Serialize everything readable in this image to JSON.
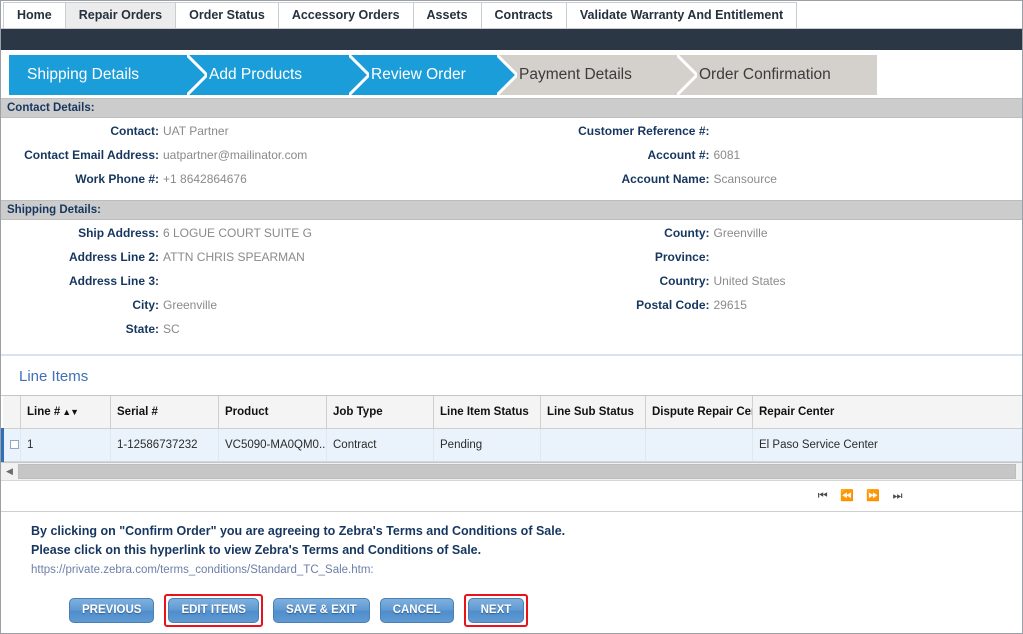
{
  "nav": {
    "tabs": [
      {
        "label": "Home",
        "active": false
      },
      {
        "label": "Repair Orders",
        "active": true
      },
      {
        "label": "Order Status",
        "active": false
      },
      {
        "label": "Accessory Orders",
        "active": false
      },
      {
        "label": "Assets",
        "active": false
      },
      {
        "label": "Contracts",
        "active": false
      },
      {
        "label": "Validate Warranty And Entitlement",
        "active": false
      }
    ]
  },
  "stepper": {
    "steps": [
      {
        "label": "Shipping Details",
        "state": "done"
      },
      {
        "label": "Add Products",
        "state": "done"
      },
      {
        "label": "Review Order",
        "state": "done"
      },
      {
        "label": "Payment Details",
        "state": "todo"
      },
      {
        "label": "Order Confirmation",
        "state": "todo"
      }
    ]
  },
  "contact_section": {
    "title": "Contact Details:",
    "left": [
      {
        "label": "Contact:",
        "value": "UAT Partner"
      },
      {
        "label": "Contact Email Address:",
        "value": "uatpartner@mailinator.com"
      },
      {
        "label": "Work Phone #:",
        "value": "+1 8642864676"
      }
    ],
    "right": [
      {
        "label": "Customer Reference #:",
        "value": ""
      },
      {
        "label": "Account #:",
        "value": "6081"
      },
      {
        "label": "Account Name:",
        "value": "Scansource"
      }
    ]
  },
  "shipping_section": {
    "title": "Shipping Details:",
    "left": [
      {
        "label": "Ship Address:",
        "value": "6 LOGUE COURT SUITE G"
      },
      {
        "label": "Address Line 2:",
        "value": "ATTN CHRIS SPEARMAN"
      },
      {
        "label": "Address Line 3:",
        "value": ""
      },
      {
        "label": "City:",
        "value": "Greenville"
      },
      {
        "label": "State:",
        "value": "SC"
      }
    ],
    "right": [
      {
        "label": "County:",
        "value": "Greenville"
      },
      {
        "label": "Province:",
        "value": ""
      },
      {
        "label": "Country:",
        "value": "United States"
      },
      {
        "label": "Postal Code:",
        "value": "29615"
      }
    ]
  },
  "line_items": {
    "panel_title": "Line Items",
    "columns": [
      "Line #",
      "Serial #",
      "Product",
      "Job Type",
      "Line Item Status",
      "Line Sub Status",
      "Dispute Repair Cent",
      "Repair Center"
    ],
    "sort_arrows": "▲▼",
    "rows": [
      {
        "line_no": "1",
        "serial": "1-12586737232",
        "product": "VC5090-MA0QM0...",
        "job_type": "Contract",
        "line_item_status": "Pending",
        "line_sub_status": "",
        "dispute_repair_center": "",
        "repair_center": "El Paso Service Center"
      }
    ],
    "pager": {
      "first": "⏮",
      "prev": "⏪",
      "next": "⏩",
      "last": "⏭"
    },
    "scroll_left_arrow": "◀"
  },
  "terms": {
    "line1": "By clicking on \"Confirm Order\" you are agreeing to Zebra's Terms and Conditions of Sale.",
    "line2": "Please click on this hyperlink to view Zebra's Terms and Conditions of Sale.",
    "link": "https://private.zebra.com/terms_conditions/Standard_TC_Sale.htm:"
  },
  "buttons": [
    {
      "label": "PREVIOUS",
      "highlighted": false
    },
    {
      "label": "EDIT ITEMS",
      "highlighted": true
    },
    {
      "label": "SAVE & EXIT",
      "highlighted": false
    },
    {
      "label": "CANCEL",
      "highlighted": false
    },
    {
      "label": "NEXT",
      "highlighted": true
    }
  ],
  "colors": {
    "step_active": "#1b9dd9",
    "step_inactive": "#d4d0cb",
    "dark_band": "#2b3745",
    "section_bar": "#cccccc",
    "label_blue": "#16365f",
    "panel_title_blue": "#3f6fb5",
    "row_blue": "#eaf3fb",
    "highlight_red": "#e8131a",
    "button_blue": "#5f9ad3"
  }
}
